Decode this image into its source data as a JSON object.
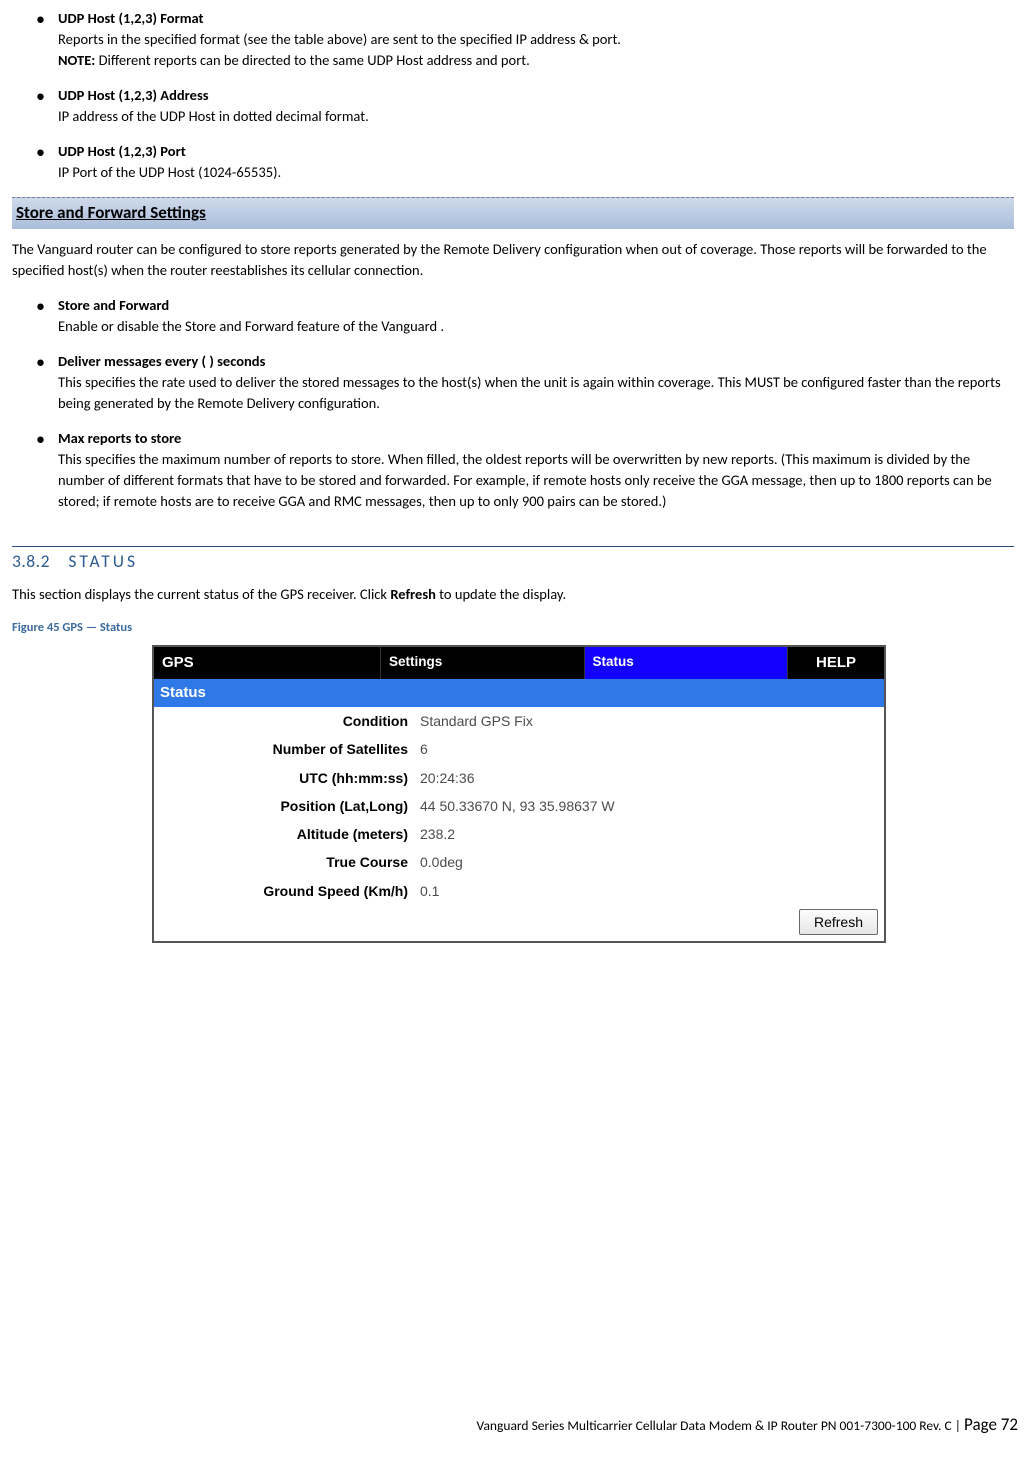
{
  "top_items": [
    {
      "title": "UDP Host (1,2,3) Format",
      "body_parts": [
        {
          "text": "Reports in the specified format (see the table above) are sent to the specified IP address & port.",
          "bold": false,
          "break_after": true
        },
        {
          "text": "NOTE:",
          "bold": true,
          "break_after": false
        },
        {
          "text": " Different reports can be directed to the same UDP Host address and port.",
          "bold": false,
          "break_after": false
        }
      ]
    },
    {
      "title": "UDP Host (1,2,3) Address",
      "body_parts": [
        {
          "text": "IP address of the UDP Host in dotted decimal format.",
          "bold": false,
          "break_after": false
        }
      ]
    },
    {
      "title": "UDP Host (1,2,3) Port",
      "body_parts": [
        {
          "text": "IP Port of the UDP Host (1024-65535).",
          "bold": false,
          "break_after": false
        }
      ]
    }
  ],
  "store_section_title": "Store and Forward Settings",
  "store_intro": "The Vanguard router can be configured to store reports generated by the Remote Delivery configuration when out of coverage. Those reports will be forwarded to the specified host(s) when the router reestablishes its cellular connection.",
  "store_items": [
    {
      "title": "Store and Forward",
      "body": "Enable or disable the Store and Forward feature of the Vanguard ."
    },
    {
      "title": "Deliver messages every ( ) seconds",
      "body": "This specifies the rate used to deliver the stored messages to the host(s) when the unit is again within coverage. This MUST be configured faster than the reports being generated by the Remote Delivery configuration."
    },
    {
      "title": "Max reports to store",
      "body": "This specifies the maximum number of reports to store. When filled, the oldest reports will be overwritten by new reports. (This maximum is divided by the number of different formats that have to be stored and forwarded. For example, if remote hosts only receive the GGA message, then up to 1800 reports can be stored; if remote hosts are to receive GGA and RMC messages, then up to only 900 pairs can be stored.)"
    }
  ],
  "status_heading_num": "3.8.2",
  "status_heading_title": "STATUS",
  "status_intro_pre": "This section displays the current status of the GPS receiver. Click ",
  "status_intro_bold": "Refresh",
  "status_intro_post": " to update the display.",
  "figure_label": "Figure 45 GPS — Status",
  "gps_tabs": {
    "title": "GPS",
    "settings": "Settings",
    "status": "Status",
    "help": "HELP"
  },
  "gps_status_label": "Status",
  "gps_rows": [
    {
      "label": "Condition",
      "value": "Standard GPS Fix"
    },
    {
      "label": "Number of Satellites",
      "value": "6"
    },
    {
      "label": "UTC (hh:mm:ss)",
      "value": "20:24:36"
    },
    {
      "label": "Position (Lat,Long)",
      "value": "44 50.33670 N, 93 35.98637 W"
    },
    {
      "label": "Altitude (meters)",
      "value": "238.2"
    },
    {
      "label": "True Course",
      "value": "0.0deg"
    },
    {
      "label": "Ground Speed (Km/h)",
      "value": "0.1"
    }
  ],
  "refresh_label": "Refresh",
  "footer_left": "Vanguard Series Multicarrier Cellular Data Modem & IP Router PN 001-7300-100 Rev. C",
  "footer_sep": " | ",
  "footer_page_word": "Page ",
  "footer_page_num": "72"
}
